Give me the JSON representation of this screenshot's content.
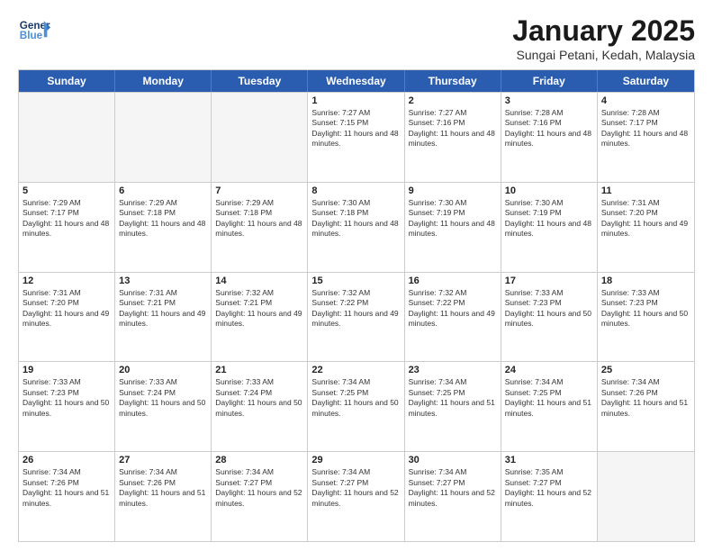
{
  "header": {
    "logo_general": "General",
    "logo_blue": "Blue",
    "month_title": "January 2025",
    "subtitle": "Sungai Petani, Kedah, Malaysia"
  },
  "days_of_week": [
    "Sunday",
    "Monday",
    "Tuesday",
    "Wednesday",
    "Thursday",
    "Friday",
    "Saturday"
  ],
  "weeks": [
    [
      {
        "day": "",
        "empty": true
      },
      {
        "day": "",
        "empty": true
      },
      {
        "day": "",
        "empty": true
      },
      {
        "day": "1",
        "sunrise": "7:27 AM",
        "sunset": "7:15 PM",
        "daylight": "11 hours and 48 minutes."
      },
      {
        "day": "2",
        "sunrise": "7:27 AM",
        "sunset": "7:16 PM",
        "daylight": "11 hours and 48 minutes."
      },
      {
        "day": "3",
        "sunrise": "7:28 AM",
        "sunset": "7:16 PM",
        "daylight": "11 hours and 48 minutes."
      },
      {
        "day": "4",
        "sunrise": "7:28 AM",
        "sunset": "7:17 PM",
        "daylight": "11 hours and 48 minutes."
      }
    ],
    [
      {
        "day": "5",
        "sunrise": "7:29 AM",
        "sunset": "7:17 PM",
        "daylight": "11 hours and 48 minutes."
      },
      {
        "day": "6",
        "sunrise": "7:29 AM",
        "sunset": "7:18 PM",
        "daylight": "11 hours and 48 minutes."
      },
      {
        "day": "7",
        "sunrise": "7:29 AM",
        "sunset": "7:18 PM",
        "daylight": "11 hours and 48 minutes."
      },
      {
        "day": "8",
        "sunrise": "7:30 AM",
        "sunset": "7:18 PM",
        "daylight": "11 hours and 48 minutes."
      },
      {
        "day": "9",
        "sunrise": "7:30 AM",
        "sunset": "7:19 PM",
        "daylight": "11 hours and 48 minutes."
      },
      {
        "day": "10",
        "sunrise": "7:30 AM",
        "sunset": "7:19 PM",
        "daylight": "11 hours and 48 minutes."
      },
      {
        "day": "11",
        "sunrise": "7:31 AM",
        "sunset": "7:20 PM",
        "daylight": "11 hours and 49 minutes."
      }
    ],
    [
      {
        "day": "12",
        "sunrise": "7:31 AM",
        "sunset": "7:20 PM",
        "daylight": "11 hours and 49 minutes."
      },
      {
        "day": "13",
        "sunrise": "7:31 AM",
        "sunset": "7:21 PM",
        "daylight": "11 hours and 49 minutes."
      },
      {
        "day": "14",
        "sunrise": "7:32 AM",
        "sunset": "7:21 PM",
        "daylight": "11 hours and 49 minutes."
      },
      {
        "day": "15",
        "sunrise": "7:32 AM",
        "sunset": "7:22 PM",
        "daylight": "11 hours and 49 minutes."
      },
      {
        "day": "16",
        "sunrise": "7:32 AM",
        "sunset": "7:22 PM",
        "daylight": "11 hours and 49 minutes."
      },
      {
        "day": "17",
        "sunrise": "7:33 AM",
        "sunset": "7:23 PM",
        "daylight": "11 hours and 50 minutes."
      },
      {
        "day": "18",
        "sunrise": "7:33 AM",
        "sunset": "7:23 PM",
        "daylight": "11 hours and 50 minutes."
      }
    ],
    [
      {
        "day": "19",
        "sunrise": "7:33 AM",
        "sunset": "7:23 PM",
        "daylight": "11 hours and 50 minutes."
      },
      {
        "day": "20",
        "sunrise": "7:33 AM",
        "sunset": "7:24 PM",
        "daylight": "11 hours and 50 minutes."
      },
      {
        "day": "21",
        "sunrise": "7:33 AM",
        "sunset": "7:24 PM",
        "daylight": "11 hours and 50 minutes."
      },
      {
        "day": "22",
        "sunrise": "7:34 AM",
        "sunset": "7:25 PM",
        "daylight": "11 hours and 50 minutes."
      },
      {
        "day": "23",
        "sunrise": "7:34 AM",
        "sunset": "7:25 PM",
        "daylight": "11 hours and 51 minutes."
      },
      {
        "day": "24",
        "sunrise": "7:34 AM",
        "sunset": "7:25 PM",
        "daylight": "11 hours and 51 minutes."
      },
      {
        "day": "25",
        "sunrise": "7:34 AM",
        "sunset": "7:26 PM",
        "daylight": "11 hours and 51 minutes."
      }
    ],
    [
      {
        "day": "26",
        "sunrise": "7:34 AM",
        "sunset": "7:26 PM",
        "daylight": "11 hours and 51 minutes."
      },
      {
        "day": "27",
        "sunrise": "7:34 AM",
        "sunset": "7:26 PM",
        "daylight": "11 hours and 51 minutes."
      },
      {
        "day": "28",
        "sunrise": "7:34 AM",
        "sunset": "7:27 PM",
        "daylight": "11 hours and 52 minutes."
      },
      {
        "day": "29",
        "sunrise": "7:34 AM",
        "sunset": "7:27 PM",
        "daylight": "11 hours and 52 minutes."
      },
      {
        "day": "30",
        "sunrise": "7:34 AM",
        "sunset": "7:27 PM",
        "daylight": "11 hours and 52 minutes."
      },
      {
        "day": "31",
        "sunrise": "7:35 AM",
        "sunset": "7:27 PM",
        "daylight": "11 hours and 52 minutes."
      },
      {
        "day": "",
        "empty": true
      }
    ]
  ]
}
